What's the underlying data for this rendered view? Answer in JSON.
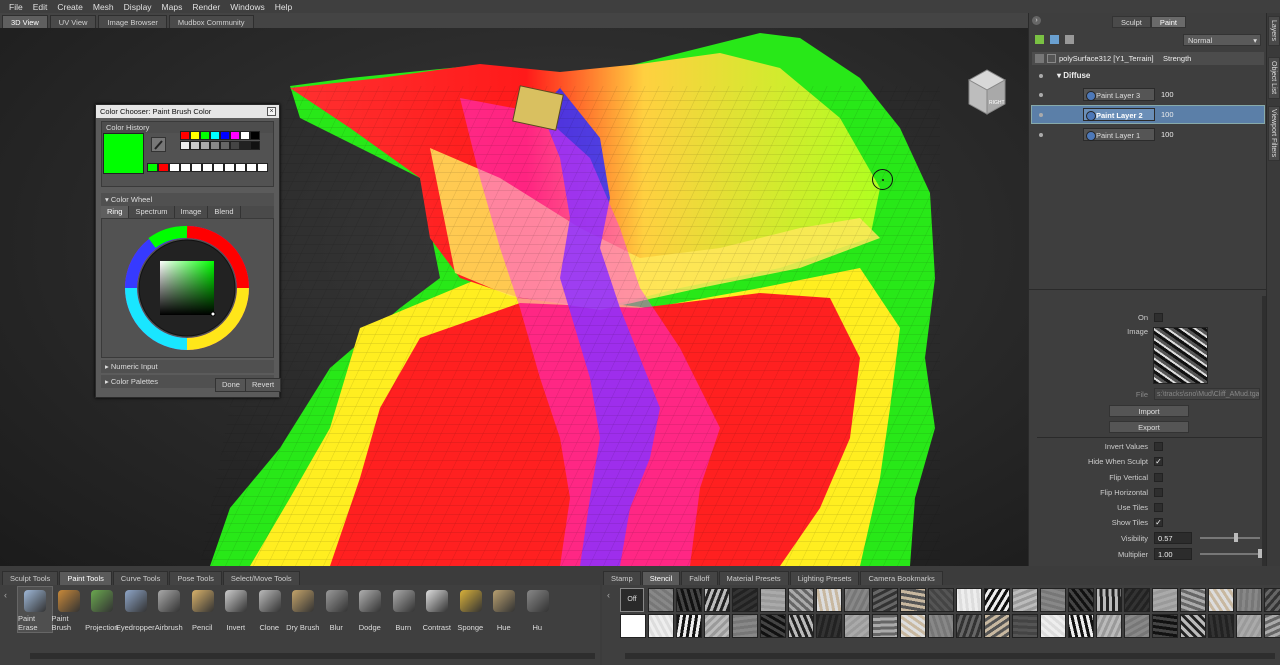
{
  "menu": [
    "File",
    "Edit",
    "Create",
    "Mesh",
    "Display",
    "Maps",
    "Render",
    "Windows",
    "Help"
  ],
  "view_tabs": [
    {
      "label": "3D View",
      "active": true
    },
    {
      "label": "UV View",
      "active": false
    },
    {
      "label": "Image Browser",
      "active": false
    },
    {
      "label": "Mudbox Community",
      "active": false
    }
  ],
  "viewcube_label": "RIGHT",
  "color_chooser": {
    "title": "Color Chooser: Paint Brush Color",
    "history_label": "Color History",
    "wheel_label": "Color Wheel",
    "tabs": [
      "Ring",
      "Spectrum",
      "Image",
      "Blend"
    ],
    "active_tab": "Ring",
    "numeric_label": "Numeric Input",
    "palettes_label": "Color Palettes",
    "done": "Done",
    "revert": "Revert",
    "current_color": "#00ff00"
  },
  "right_panel": {
    "modes": [
      "Sculpt",
      "Paint"
    ],
    "active_mode": "Paint",
    "blend_mode": "Normal",
    "header_object": "polySurface312 [Y1_Terrain]",
    "header_strength": "Strength",
    "group": "Diffuse",
    "layers": [
      {
        "name": "Paint Layer 3",
        "value": "100",
        "selected": false
      },
      {
        "name": "Paint Layer 2",
        "value": "100",
        "selected": true
      },
      {
        "name": "Paint Layer 1",
        "value": "100",
        "selected": false
      }
    ],
    "side_tabs": [
      "Layers",
      "Object List",
      "Viewport Filters"
    ],
    "props": {
      "on_label": "On",
      "image_label": "Image",
      "file_label": "File",
      "file_value": "s:\\tracks\\sno\\Mud\\Cliff_AMud.tga",
      "import": "Import",
      "export": "Export",
      "invert_values": "Invert Values",
      "hide_when_sculpt": "Hide When Sculpt",
      "flip_vertical": "Flip Vertical",
      "flip_horizontal": "Flip Horizontal",
      "use_tiles": "Use Tiles",
      "show_tiles": "Show Tiles",
      "visibility": "Visibility",
      "visibility_value": "0.57",
      "multiplier": "Multiplier",
      "multiplier_value": "1.00"
    }
  },
  "tool_tabs": [
    {
      "label": "Sculpt Tools",
      "active": false
    },
    {
      "label": "Paint Tools",
      "active": true
    },
    {
      "label": "Curve Tools",
      "active": false
    },
    {
      "label": "Pose Tools",
      "active": false
    },
    {
      "label": "Select/Move Tools",
      "active": false
    }
  ],
  "tools": [
    {
      "label": "Paint Erase",
      "icon": "eraser-icon",
      "color": "#9fb8d8",
      "active": true
    },
    {
      "label": "Paint Brush",
      "icon": "paint-brush-icon",
      "color": "#c98a3a"
    },
    {
      "label": "Projection",
      "icon": "projection-icon",
      "color": "#6aa84f"
    },
    {
      "label": "Eyedropper",
      "icon": "eyedropper-icon",
      "color": "#8fa6c8"
    },
    {
      "label": "Airbrush",
      "icon": "airbrush-icon",
      "color": "#aaaaaa"
    },
    {
      "label": "Pencil",
      "icon": "pencil-icon",
      "color": "#d9b26a"
    },
    {
      "label": "Invert",
      "icon": "invert-icon",
      "color": "#cccccc"
    },
    {
      "label": "Clone",
      "icon": "clone-stamp-icon",
      "color": "#bbbbbb"
    },
    {
      "label": "Dry Brush",
      "icon": "dry-brush-icon",
      "color": "#c4a46a"
    },
    {
      "label": "Blur",
      "icon": "blur-drop-icon",
      "color": "#9a9a9a"
    },
    {
      "label": "Dodge",
      "icon": "dodge-icon",
      "color": "#b0b0b0"
    },
    {
      "label": "Burn",
      "icon": "burn-icon",
      "color": "#aaaaaa"
    },
    {
      "label": "Contrast",
      "icon": "contrast-icon",
      "color": "#dddddd"
    },
    {
      "label": "Sponge",
      "icon": "sponge-icon",
      "color": "#d9b13a"
    },
    {
      "label": "Hue",
      "icon": "hue-icon",
      "color": "#b8a070"
    },
    {
      "label": "Hu",
      "icon": "hue-shift-icon",
      "color": "#888888"
    }
  ],
  "stamp_tabs": [
    {
      "label": "Stamp",
      "active": false
    },
    {
      "label": "Stencil",
      "active": true
    },
    {
      "label": "Falloff",
      "active": false
    },
    {
      "label": "Material Presets",
      "active": false
    },
    {
      "label": "Lighting Presets",
      "active": false
    },
    {
      "label": "Camera Bookmarks",
      "active": false
    }
  ],
  "stamp_off": "Off"
}
